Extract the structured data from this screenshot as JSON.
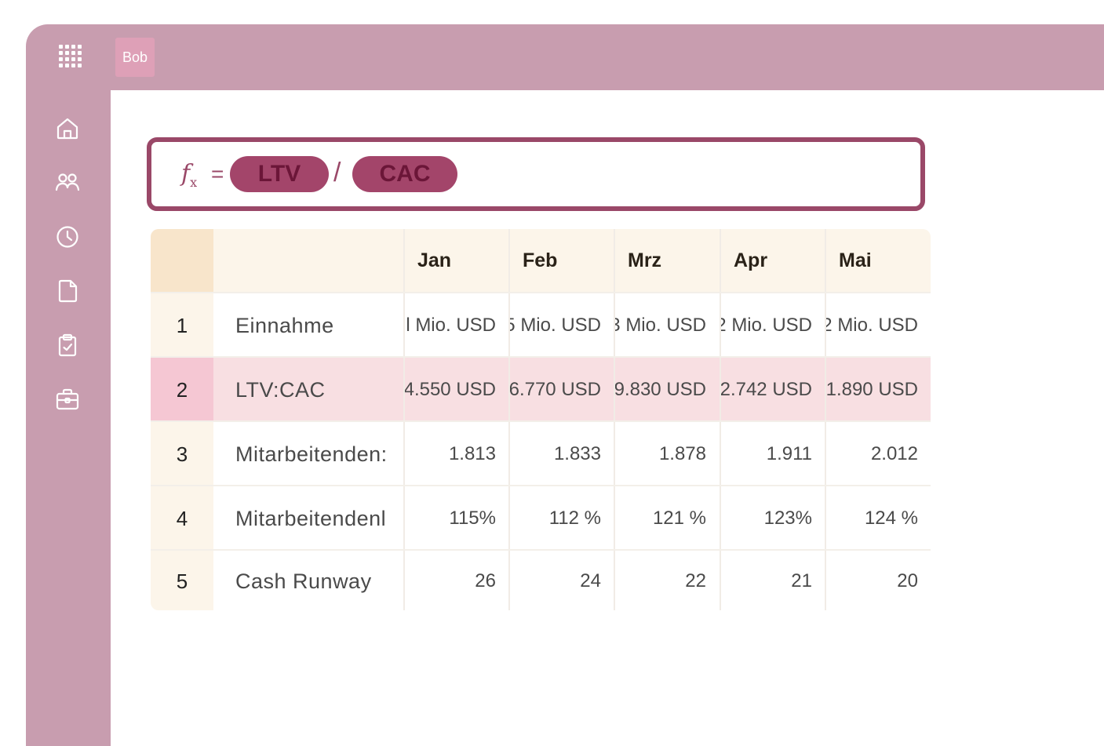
{
  "header": {
    "badge": "Bob"
  },
  "nav": [
    "home-icon",
    "users-icon",
    "clock-icon",
    "document-icon",
    "clipboard-check-icon",
    "briefcase-icon"
  ],
  "formula": {
    "fx_label": "f",
    "fx_sub": "x",
    "equals": "=",
    "operand1": "LTV",
    "operator": "/",
    "operand2": "CAC"
  },
  "colors": {
    "sidebar": "#c89daf",
    "accent": "#9a4868",
    "pill": "#a3456a",
    "header_bg": "#fcf5ea",
    "highlight_row": "#f8dfe2"
  },
  "table": {
    "columns": [
      "Jan",
      "Feb",
      "Mrz",
      "Apr",
      "Mai"
    ],
    "rows": [
      {
        "index": "1",
        "label": "Einnahme",
        "values": [
          "l Mio. USD",
          "5 Mio. USD",
          "3 Mio. USD",
          "2 Mio. USD",
          "2 Mio. USD"
        ]
      },
      {
        "index": "2",
        "label": "LTV:CAC",
        "values": [
          "4.550 USD",
          "6.770 USD",
          "9.830 USD",
          "2.742 USD",
          "1.890 USD"
        ]
      },
      {
        "index": "3",
        "label": "Mitarbeitenden:",
        "values": [
          "1.813",
          "1.833",
          "1.878",
          "1.911",
          "2.012"
        ]
      },
      {
        "index": "4",
        "label": "Mitarbeitendenl",
        "values": [
          "115%",
          "112 %",
          "121 %",
          "123%",
          "124 %"
        ]
      },
      {
        "index": "5",
        "label": "Cash Runway",
        "values": [
          "26",
          "24",
          "22",
          "21",
          "20"
        ]
      }
    ]
  }
}
